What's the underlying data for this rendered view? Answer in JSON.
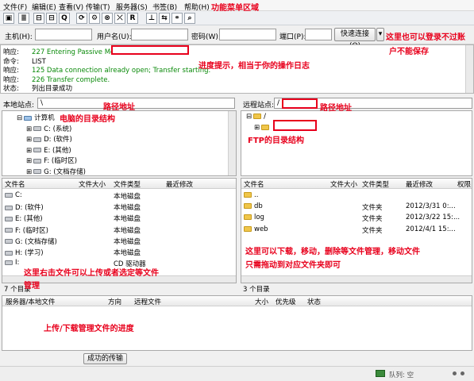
{
  "menu": [
    "文件(F)",
    "编辑(E)",
    "查看(V)",
    "传输(T)",
    "服务器(S)",
    "书签(B)",
    "帮助(H)"
  ],
  "toolbar_icons": [
    "site-manager-icon",
    "toggle-log-icon",
    "toggle-local-tree-icon",
    "toggle-remote-tree-icon",
    "toggle-queue-icon",
    "refresh-icon",
    "process-queue-icon",
    "cancel-icon",
    "disconnect-icon",
    "reconnect-icon",
    "filter-icon",
    "compare-icon",
    "sync-browse-icon",
    "search-icon"
  ],
  "toolbar_glyphs": [
    "▣",
    "≣",
    "⊟",
    "⊟",
    "Q",
    "⟳",
    "⚙",
    "⊗",
    "⤫",
    "R",
    "⊥",
    "⇆",
    "⚭",
    "⌕"
  ],
  "quickconnect": {
    "host_label": "主机(H):",
    "user_label": "用户名(U):",
    "pass_label": "密码(W):",
    "port_label": "端口(P):",
    "connect_button": "快速连接(Q)",
    "dropdown_glyph": "▾"
  },
  "log": [
    {
      "key": "响应:",
      "text": "227 Entering Passive Mode",
      "green": true
    },
    {
      "key": "命令:",
      "text": "LIST",
      "green": false
    },
    {
      "key": "响应:",
      "text": "125 Data connection already open; Transfer starting.",
      "green": true
    },
    {
      "key": "响应:",
      "text": "226 Transfer complete.",
      "green": true
    },
    {
      "key": "状态:",
      "text": "列出目录成功",
      "green": false
    }
  ],
  "local": {
    "site_label": "本地站点:",
    "path": "\\",
    "tree": [
      {
        "label": "计算机",
        "expander": "⊟",
        "icon": "computer"
      },
      {
        "label": "C: (系统)",
        "expander": "⊞",
        "icon": "drive"
      },
      {
        "label": "D: (软件)",
        "expander": "⊞",
        "icon": "drive"
      },
      {
        "label": "E: (其他)",
        "expander": "⊞",
        "icon": "drive"
      },
      {
        "label": "F: (临时区)",
        "expander": "⊞",
        "icon": "drive"
      },
      {
        "label": "G: (文档存储)",
        "expander": "⊞",
        "icon": "drive"
      }
    ],
    "columns": [
      "文件名",
      "文件大小",
      "文件类型",
      "最近修改"
    ],
    "files": [
      {
        "name": "C:",
        "type": "本地磁盘"
      },
      {
        "name": "D: (软件)",
        "type": "本地磁盘"
      },
      {
        "name": "E: (其他)",
        "type": "本地磁盘"
      },
      {
        "name": "F: (临时区)",
        "type": "本地磁盘"
      },
      {
        "name": "G: (文档存储)",
        "type": "本地磁盘"
      },
      {
        "name": "H: (学习)",
        "type": "本地磁盘"
      },
      {
        "name": "I:",
        "type": "CD 驱动器"
      }
    ],
    "status": "7 个目录"
  },
  "remote": {
    "site_label": "远程站点:",
    "path": "/",
    "tree": [
      {
        "label": "/",
        "expander": "⊟",
        "icon": "question-folder"
      },
      {
        "label": "",
        "expander": "⊞",
        "icon": "folder"
      }
    ],
    "columns": [
      "文件名",
      "文件大小",
      "文件类型",
      "最近修改",
      "权限"
    ],
    "files": [
      {
        "name": "..",
        "type": "",
        "date": ""
      },
      {
        "name": "db",
        "type": "文件夹",
        "date": "2012/3/31 0:..."
      },
      {
        "name": "log",
        "type": "文件夹",
        "date": "2012/3/22 15:..."
      },
      {
        "name": "web",
        "type": "文件夹",
        "date": "2012/4/1 15:..."
      }
    ],
    "status": "3 个目录"
  },
  "queue": {
    "columns": [
      "服务器/本地文件",
      "方向",
      "远程文件",
      "大小",
      "优先级",
      "状态"
    ],
    "tab": "成功的传输",
    "footer": "队列: 空"
  },
  "annotations": {
    "menu_area": "功能菜单区域",
    "quick_login_1": "这里也可以登录不过账",
    "quick_login_2": "户不能保存",
    "log_hint": "进度提示，相当于你的操作日志",
    "local_path": "路径地址",
    "local_tree": "电脑的目录结构",
    "remote_path": "路径地址",
    "remote_tree": "FTP的目录结构",
    "local_list_1": "这里右击文件可以上传或者选定等文件",
    "local_list_2": "管理",
    "remote_list_1": "这里可以下载，移动，删除等文件管理，移动文件",
    "remote_list_2": "只需拖动到对应文件夹即可",
    "queue_hint": "上传/下载管理文件的进度"
  },
  "colors": {
    "annotation": "#e8001c",
    "log_green": "#0a8a0a",
    "folder": "#f0c64a"
  }
}
